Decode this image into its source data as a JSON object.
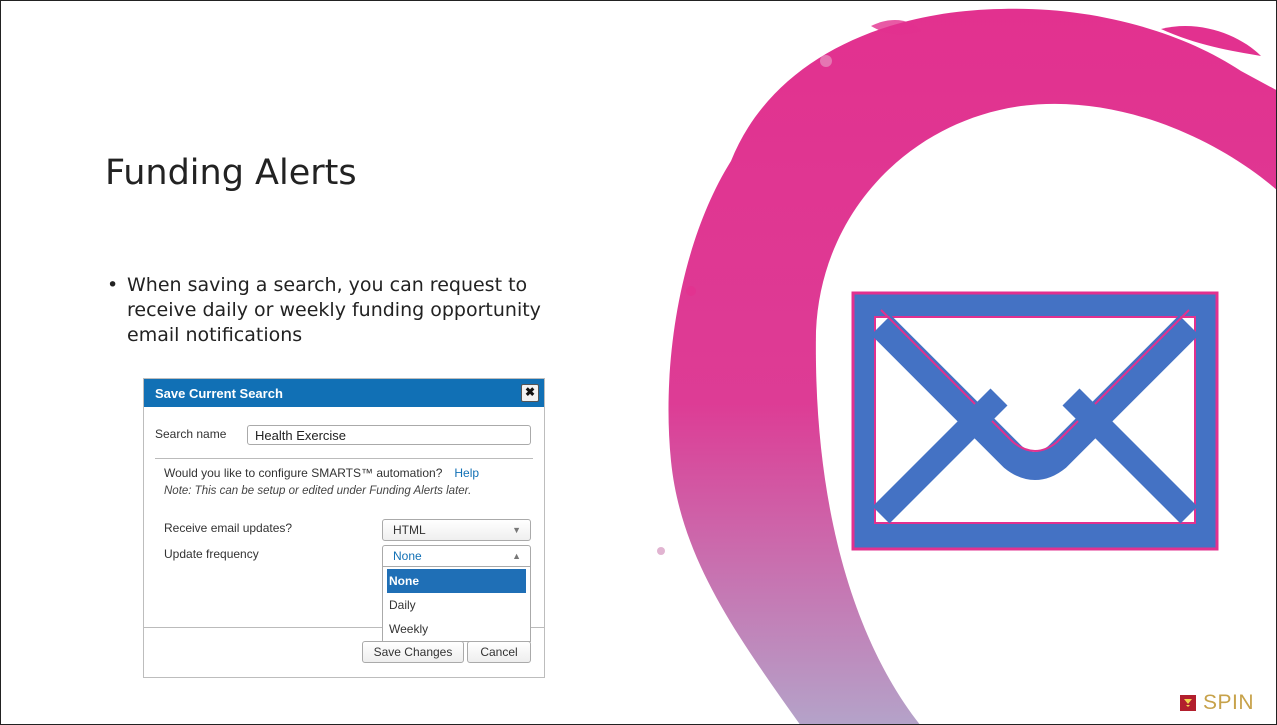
{
  "slide": {
    "title": "Funding Alerts",
    "bullet_glyph": "•",
    "bullet": "When saving a search, you can request to receive daily or weekly funding opportunity email notifications"
  },
  "dialog": {
    "title": "Save Current Search",
    "close_glyph": "✖",
    "search_name_label": "Search name",
    "search_name_value": "Health Exercise",
    "question": "Would you like to configure SMARTS™ automation?",
    "help_link": "Help",
    "note": "Note: This can be setup or edited under Funding Alerts later.",
    "email_label": "Receive email updates?",
    "email_value": "HTML",
    "frequency_label": "Update frequency",
    "frequency_value": "None",
    "frequency_options": [
      "None",
      "Daily",
      "Weekly"
    ],
    "save_button": "Save Changes",
    "cancel_button": "Cancel",
    "header_color": "#1170b5"
  },
  "graphic": {
    "brush_color": "#e2318f",
    "envelope_fill": "#4472c4",
    "envelope_stroke": "#e2318f"
  },
  "logo": {
    "text": "SPIN",
    "icon": "spin-logo-icon"
  }
}
